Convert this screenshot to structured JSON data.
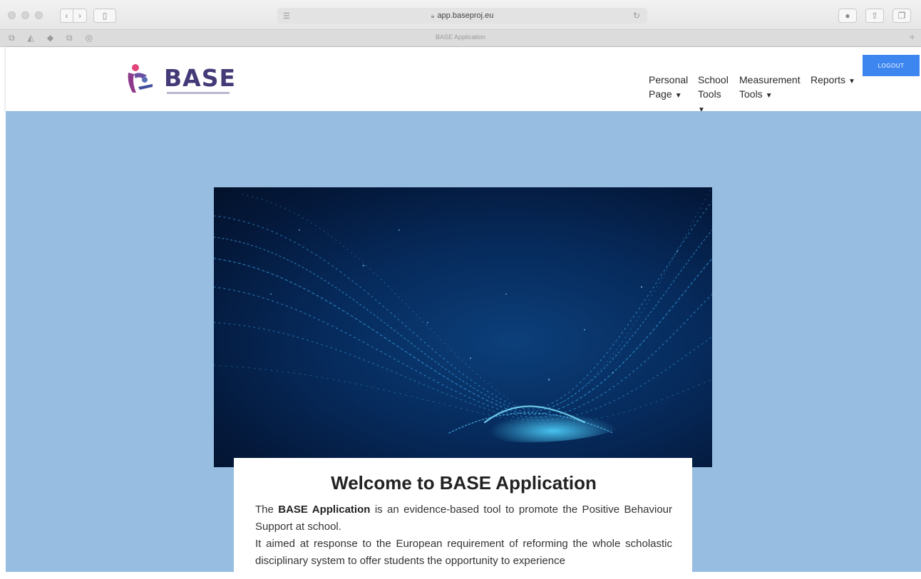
{
  "browser": {
    "url": "app.baseproj.eu",
    "tab_title": "BASE Application"
  },
  "header": {
    "logo_text": "BASE",
    "nav": [
      {
        "label": "Personal\nPage"
      },
      {
        "label": "School\nTools"
      },
      {
        "label": "Measurement\nTools"
      },
      {
        "label": "Reports"
      }
    ],
    "logout_label": "LOGOUT"
  },
  "welcome": {
    "title": "Welcome to BASE Application",
    "p1_prefix": "The ",
    "p1_bold": "BASE Application",
    "p1_suffix": " is an evidence-based tool to promote the Positive Behaviour Support at school.",
    "p2": "It aimed at response to the European requirement of reforming the whole scholastic disciplinary system to offer students the opportunity to experience"
  },
  "colors": {
    "page_background": "#97bde1",
    "logout_button": "#3d86f0",
    "logo_text": "#433a78"
  }
}
